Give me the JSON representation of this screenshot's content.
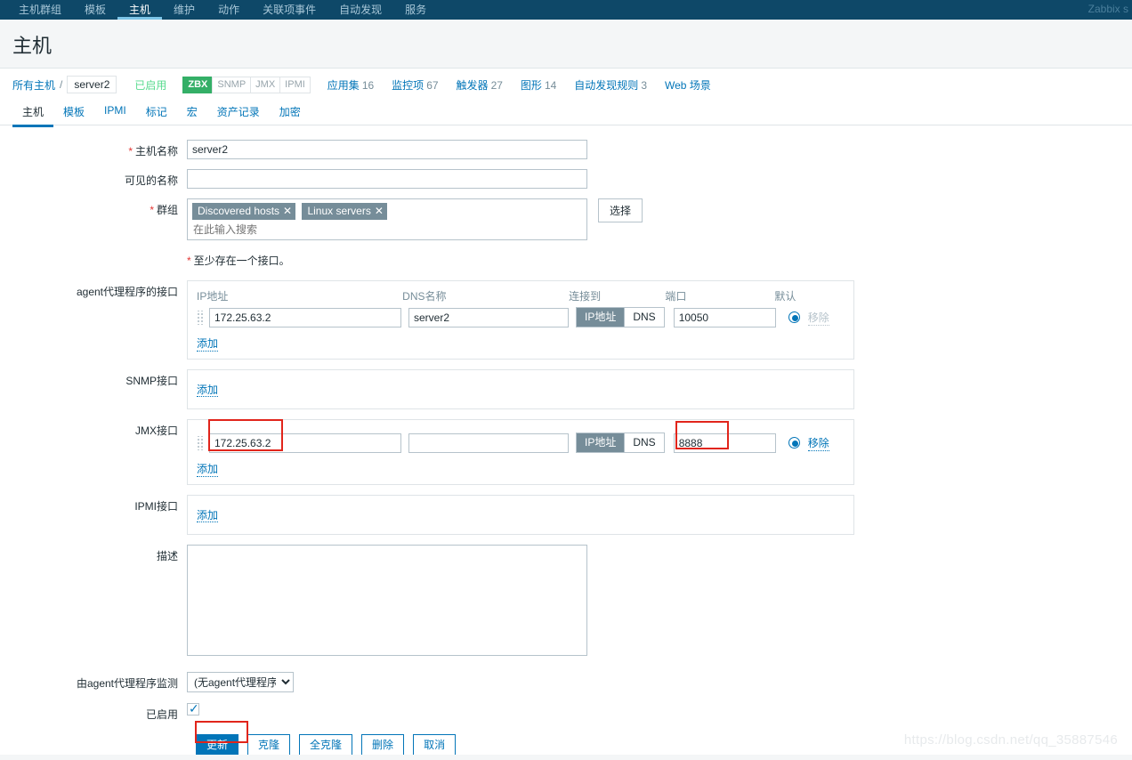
{
  "topnav": {
    "items": [
      {
        "label": "主机群组",
        "active": false
      },
      {
        "label": "模板",
        "active": false
      },
      {
        "label": "主机",
        "active": true
      },
      {
        "label": "维护",
        "active": false
      },
      {
        "label": "动作",
        "active": false
      },
      {
        "label": "关联项事件",
        "active": false
      },
      {
        "label": "自动发现",
        "active": false
      },
      {
        "label": "服务",
        "active": false
      }
    ],
    "user": "Zabbix s"
  },
  "page": {
    "title": "主机"
  },
  "breadcrumb": {
    "all_hosts": "所有主机",
    "separator": "/",
    "current": "server2",
    "status": "已启用",
    "badges": [
      {
        "label": "ZBX",
        "active": true
      },
      {
        "label": "SNMP",
        "active": false
      },
      {
        "label": "JMX",
        "active": false
      },
      {
        "label": "IPMI",
        "active": false
      }
    ],
    "links": [
      {
        "label": "应用集",
        "count": "16"
      },
      {
        "label": "监控项",
        "count": "67"
      },
      {
        "label": "触发器",
        "count": "27"
      },
      {
        "label": "图形",
        "count": "14"
      },
      {
        "label": "自动发现规则",
        "count": "3"
      },
      {
        "label": "Web 场景",
        "count": ""
      }
    ]
  },
  "tabs": [
    {
      "label": "主机",
      "active": true
    },
    {
      "label": "模板",
      "active": false
    },
    {
      "label": "IPMI",
      "active": false
    },
    {
      "label": "标记",
      "active": false
    },
    {
      "label": "宏",
      "active": false
    },
    {
      "label": "资产记录",
      "active": false
    },
    {
      "label": "加密",
      "active": false
    }
  ],
  "form": {
    "host_name": {
      "label": "主机名称",
      "value": "server2",
      "required": true
    },
    "visible_name": {
      "label": "可见的名称",
      "value": "",
      "required": false
    },
    "groups": {
      "label": "群组",
      "required": true,
      "chips": [
        "Discovered hosts",
        "Linux servers"
      ],
      "placeholder": "在此输入搜索",
      "select_button": "选择"
    },
    "interface_note": "至少存在一个接口。",
    "columns": {
      "ip": "IP地址",
      "dns": "DNS名称",
      "connect_to": "连接到",
      "port": "端口",
      "default": "默认"
    },
    "agent_interface": {
      "label": "agent代理程序的接口",
      "ip": "172.25.63.2",
      "dns": "server2",
      "connect_ip": "IP地址",
      "connect_dns": "DNS",
      "connect_selected": "IP地址",
      "port": "10050",
      "default_checked": true,
      "remove_label": "移除",
      "remove_enabled": false,
      "add_label": "添加"
    },
    "snmp_interface": {
      "label": "SNMP接口",
      "add_label": "添加"
    },
    "jmx_interface": {
      "label": "JMX接口",
      "ip": "172.25.63.2",
      "dns": "",
      "connect_ip": "IP地址",
      "connect_dns": "DNS",
      "connect_selected": "IP地址",
      "port": "8888",
      "default_checked": true,
      "remove_label": "移除",
      "remove_enabled": true,
      "add_label": "添加"
    },
    "ipmi_interface": {
      "label": "IPMI接口",
      "add_label": "添加"
    },
    "description": {
      "label": "描述",
      "value": ""
    },
    "monitored_by_proxy": {
      "label": "由agent代理程序监测",
      "selected": "(无agent代理程序)",
      "options": [
        "(无agent代理程序)"
      ]
    },
    "enabled": {
      "label": "已启用",
      "checked": true
    }
  },
  "actions": [
    {
      "label": "更新",
      "primary": true
    },
    {
      "label": "克隆",
      "primary": false
    },
    {
      "label": "全克隆",
      "primary": false
    },
    {
      "label": "删除",
      "primary": false
    },
    {
      "label": "取消",
      "primary": false
    }
  ],
  "watermark": "https://blog.csdn.net/qq_35887546",
  "colors": {
    "nav_bg": "#0e4868",
    "accent": "#0275b8",
    "ok_green": "#34af67",
    "status_green": "#59db8f",
    "annotation_red": "#e1251b",
    "chip_grey": "#768d99"
  }
}
